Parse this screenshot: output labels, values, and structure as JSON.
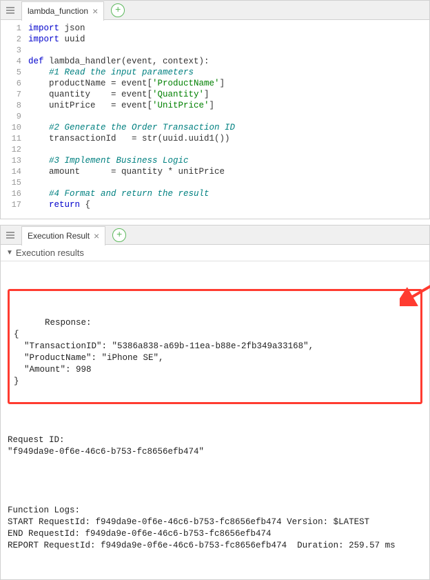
{
  "editor_tab": {
    "title": "lambda_function"
  },
  "code": {
    "lines": [
      {
        "n": 1,
        "segs": [
          [
            "kw",
            "import"
          ],
          [
            "",
            " json"
          ]
        ]
      },
      {
        "n": 2,
        "segs": [
          [
            "kw",
            "import"
          ],
          [
            "",
            " uuid"
          ]
        ]
      },
      {
        "n": 3,
        "segs": [
          [
            "",
            ""
          ]
        ]
      },
      {
        "n": 4,
        "segs": [
          [
            "kw",
            "def"
          ],
          [
            "",
            " lambda_handler(event, context):"
          ]
        ]
      },
      {
        "n": 5,
        "segs": [
          [
            "",
            "    "
          ],
          [
            "cm",
            "#1 Read the input parameters"
          ]
        ]
      },
      {
        "n": 6,
        "segs": [
          [
            "",
            "    productName = event["
          ],
          [
            "str",
            "'ProductName'"
          ],
          [
            "",
            "]"
          ]
        ]
      },
      {
        "n": 7,
        "segs": [
          [
            "",
            "    quantity    = event["
          ],
          [
            "str",
            "'Quantity'"
          ],
          [
            "",
            "]"
          ]
        ]
      },
      {
        "n": 8,
        "segs": [
          [
            "",
            "    unitPrice   = event["
          ],
          [
            "str",
            "'UnitPrice'"
          ],
          [
            "",
            "]"
          ]
        ]
      },
      {
        "n": 9,
        "segs": [
          [
            "",
            ""
          ]
        ]
      },
      {
        "n": 10,
        "segs": [
          [
            "",
            "    "
          ],
          [
            "cm",
            "#2 Generate the Order Transaction ID"
          ]
        ]
      },
      {
        "n": 11,
        "segs": [
          [
            "",
            "    transactionId   = str(uuid.uuid1())"
          ]
        ]
      },
      {
        "n": 12,
        "segs": [
          [
            "",
            ""
          ]
        ]
      },
      {
        "n": 13,
        "segs": [
          [
            "",
            "    "
          ],
          [
            "cm",
            "#3 Implement Business Logic"
          ]
        ]
      },
      {
        "n": 14,
        "segs": [
          [
            "",
            "    amount      = quantity * unitPrice"
          ]
        ]
      },
      {
        "n": 15,
        "segs": [
          [
            "",
            ""
          ]
        ]
      },
      {
        "n": 16,
        "segs": [
          [
            "",
            "    "
          ],
          [
            "cm",
            "#4 Format and return the result"
          ]
        ]
      },
      {
        "n": 17,
        "segs": [
          [
            "",
            "    "
          ],
          [
            "kw",
            "return"
          ],
          [
            "",
            " {"
          ]
        ]
      }
    ]
  },
  "results_tab": {
    "title": "Execution Result"
  },
  "results_header": "Execution results",
  "response_block": "Response:\n{\n  \"TransactionID\": \"5386a838-a69b-11ea-b88e-2fb349a33168\",\n  \"ProductName\": \"iPhone SE\",\n  \"Amount\": 998\n}",
  "request_id_block": "Request ID:\n\"f949da9e-0f6e-46c6-b753-fc8656efb474\"",
  "logs_block": "Function Logs:\nSTART RequestId: f949da9e-0f6e-46c6-b753-fc8656efb474 Version: $LATEST\nEND RequestId: f949da9e-0f6e-46c6-b753-fc8656efb474\nREPORT RequestId: f949da9e-0f6e-46c6-b753-fc8656efb474  Duration: 259.57 ms"
}
